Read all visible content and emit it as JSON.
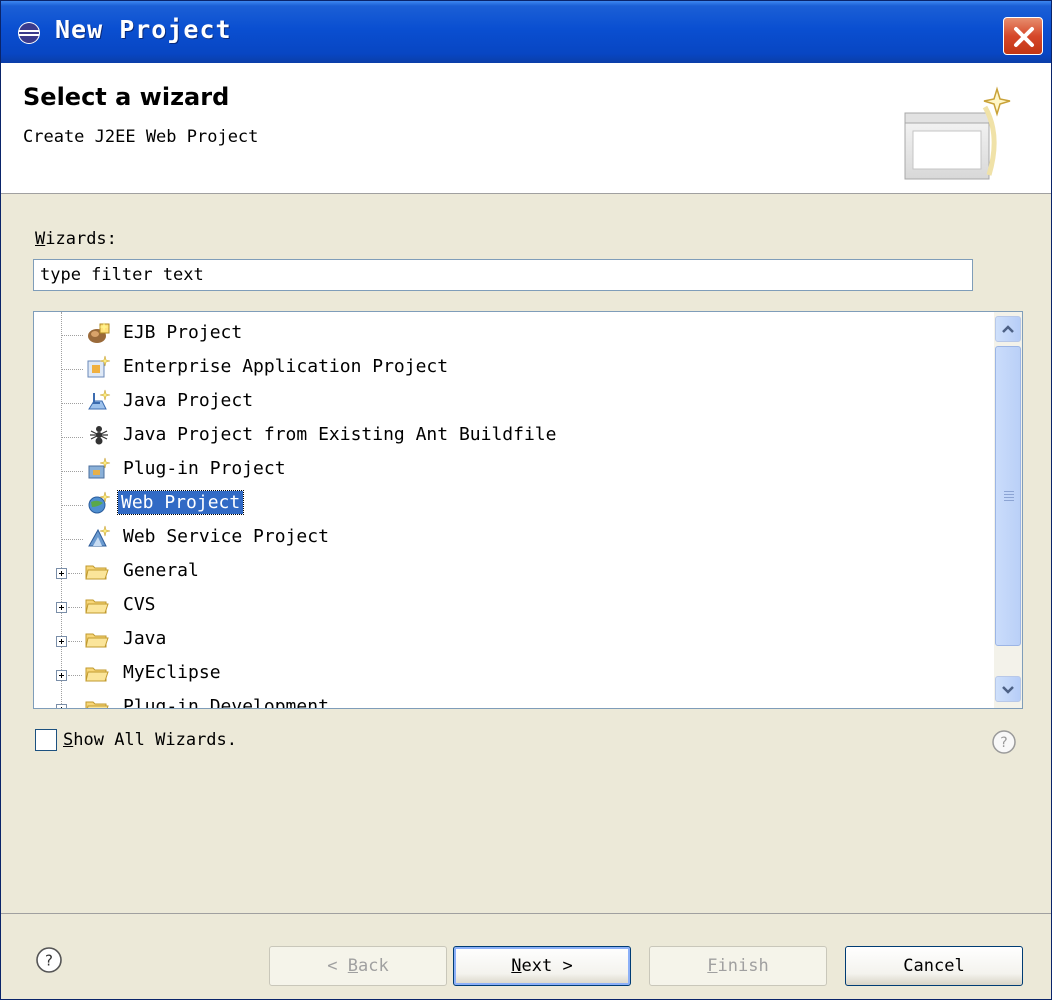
{
  "window": {
    "title": "New Project"
  },
  "header": {
    "title": "Select a wizard",
    "subtitle": "Create J2EE Web Project"
  },
  "wizards": {
    "label_mnemonic": "W",
    "label_rest": "izards:",
    "filter_value": "type filter text"
  },
  "tree": {
    "items": [
      {
        "label": "EJB Project",
        "icon": "ejb-project-icon",
        "type": "leaf"
      },
      {
        "label": "Enterprise Application Project",
        "icon": "ear-project-icon",
        "type": "leaf"
      },
      {
        "label": "Java Project",
        "icon": "java-project-icon",
        "type": "leaf"
      },
      {
        "label": "Java Project from Existing Ant Buildfile",
        "icon": "ant-icon",
        "type": "leaf"
      },
      {
        "label": "Plug-in Project",
        "icon": "plugin-project-icon",
        "type": "leaf"
      },
      {
        "label": "Web Project",
        "icon": "web-project-icon",
        "type": "leaf",
        "selected": true
      },
      {
        "label": "Web Service Project",
        "icon": "web-service-project-icon",
        "type": "leaf"
      },
      {
        "label": "General",
        "icon": "folder-icon",
        "type": "folder"
      },
      {
        "label": "CVS",
        "icon": "folder-icon",
        "type": "folder"
      },
      {
        "label": "Java",
        "icon": "folder-icon",
        "type": "folder"
      },
      {
        "label": "MyEclipse",
        "icon": "folder-icon",
        "type": "folder"
      },
      {
        "label": "Plug-in Development",
        "icon": "folder-icon",
        "type": "folder"
      }
    ]
  },
  "show_all": {
    "mnemonic": "S",
    "rest": "how All Wizards.",
    "checked": false
  },
  "buttons": {
    "back_prefix": "< ",
    "back_mnemonic": "B",
    "back_rest": "ack",
    "next_mnemonic": "N",
    "next_rest": "ext >",
    "finish_mnemonic": "F",
    "finish_rest": "inish",
    "cancel": "Cancel"
  },
  "colors": {
    "selection": "#316ac5",
    "titlebar": "#0a4fd1",
    "dialog_bg": "#ece9d8"
  }
}
